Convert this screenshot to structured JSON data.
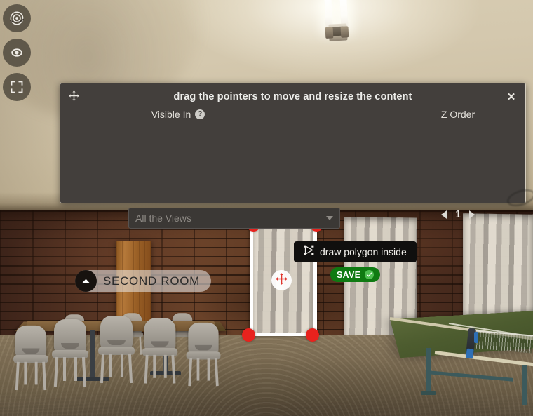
{
  "viewer": {
    "toolbar": [
      {
        "name": "gyroscope-toggle",
        "icon": "target-icon",
        "title": "Gyroscope"
      },
      {
        "name": "view-toggle",
        "icon": "eye-icon",
        "title": "View"
      },
      {
        "name": "fullscreen-toggle",
        "icon": "fullscreen-icon",
        "title": "Fullscreen"
      }
    ],
    "hotspot": {
      "label": "SECOND ROOM",
      "icon": "chevron-up-icon"
    },
    "selection": {
      "handle_color": "#e8221d",
      "border_color": "#ffffff",
      "move_icon": "move-cross-icon",
      "handle_count": 4
    }
  },
  "dialog": {
    "title": "drag the pointers to move and resize the content",
    "move_icon": "move-cross-icon",
    "close_label": "✕",
    "visible_in": {
      "label": "Visible In",
      "help_badge": "?",
      "selected": "All the Views",
      "caret_icon": "chevron-down-icon"
    },
    "z_order": {
      "label": "Z Order",
      "value": "1",
      "prev_icon": "caret-left-icon",
      "next_icon": "caret-right-icon"
    },
    "draw_button": {
      "label": "draw polygon inside",
      "icon": "polygon-icon"
    },
    "save_button": {
      "label": "SAVE",
      "icon": "check-circle-icon",
      "color": "#0f7a12"
    }
  }
}
